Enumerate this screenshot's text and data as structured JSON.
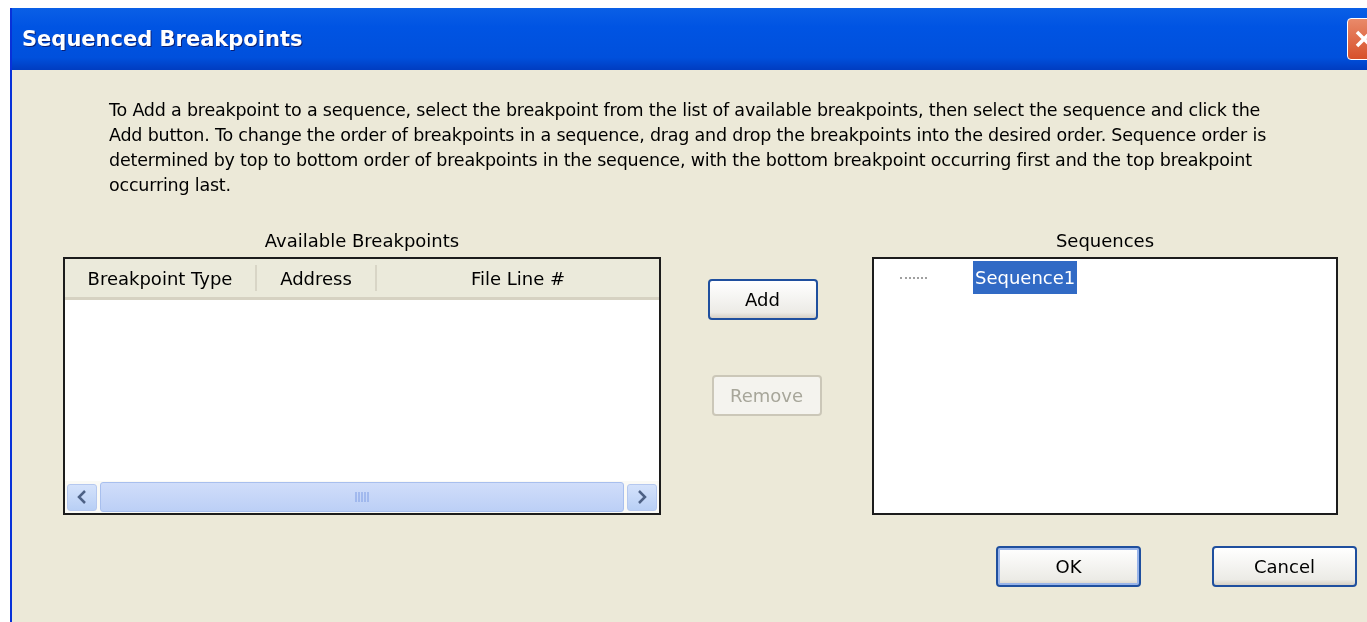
{
  "window": {
    "title": "Sequenced Breakpoints"
  },
  "instructions": "To Add a breakpoint to a sequence, select the breakpoint from the list of available breakpoints, then select the sequence and click the Add button. To change the order of breakpoints in a sequence, drag and drop the breakpoints into the desired order. Sequence order is determined by top to bottom order of breakpoints in the sequence, with the bottom breakpoint occurring first and the top breakpoint occurring last.",
  "available": {
    "label": "Available Breakpoints",
    "columns": [
      "Breakpoint Type",
      "Address",
      "File Line #"
    ]
  },
  "actions": [
    {
      "label": "Add",
      "disabled": false
    },
    {
      "label": "Remove",
      "disabled": true
    }
  ],
  "sequences": {
    "label": "Sequences",
    "items": [
      {
        "label": "Sequence1",
        "selected": true
      }
    ]
  },
  "buttons": [
    {
      "label": "OK",
      "default": true
    },
    {
      "label": "Cancel",
      "default": false
    }
  ]
}
